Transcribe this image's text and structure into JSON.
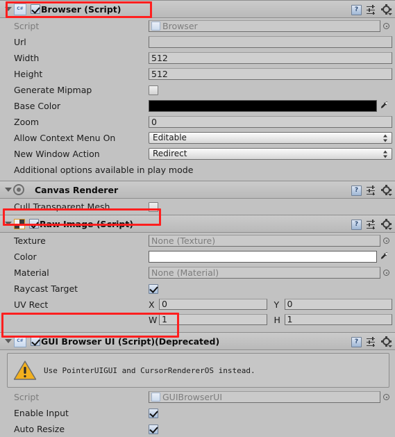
{
  "window": {
    "app": "Unity Inspector",
    "background": "#c2c2c2",
    "annotation_color": "#ff1f1f"
  },
  "header_icons": {
    "help": "?",
    "help_name": "help-icon",
    "preset_name": "preset-icon",
    "gear_name": "gear-icon"
  },
  "components": [
    {
      "name": "browser",
      "title": "Browser (Script)",
      "icon": "csharp-script-icon",
      "enabled": true,
      "highlighted": true,
      "rows": [
        {
          "kind": "object",
          "label": "Script",
          "label_dim": true,
          "value": "Browser",
          "has_picker": true
        },
        {
          "kind": "text",
          "label": "Url",
          "value": ""
        },
        {
          "kind": "text",
          "label": "Width",
          "value": "512"
        },
        {
          "kind": "text",
          "label": "Height",
          "value": "512"
        },
        {
          "kind": "checkbox",
          "label": "Generate Mipmap",
          "checked": false
        },
        {
          "kind": "color",
          "label": "Base Color",
          "color": "#000000"
        },
        {
          "kind": "text",
          "label": "Zoom",
          "value": "0"
        },
        {
          "kind": "dropdown",
          "label": "Allow Context Menu On",
          "value": "Editable"
        },
        {
          "kind": "dropdown",
          "label": "New Window Action",
          "value": "Redirect"
        },
        {
          "kind": "note",
          "label": "Additional options available in play mode"
        }
      ]
    },
    {
      "name": "canvas-renderer",
      "title": "Canvas Renderer",
      "icon": "canvas-renderer-icon",
      "enabled": null,
      "highlighted": false,
      "rows": [
        {
          "kind": "checkbox",
          "label": "Cull Transparent Mesh",
          "checked": false
        }
      ]
    },
    {
      "name": "raw-image",
      "title": "Raw Image (Script)",
      "icon": "checker-texture-icon",
      "enabled": true,
      "highlighted": true,
      "rows": [
        {
          "kind": "object",
          "label": "Texture",
          "value": "None (Texture)",
          "has_picker": true
        },
        {
          "kind": "color",
          "label": "Color",
          "color": "#ffffff"
        },
        {
          "kind": "object",
          "label": "Material",
          "value": "None (Material)",
          "has_picker": true
        },
        {
          "kind": "checkbox",
          "label": "Raycast Target",
          "checked": true
        },
        {
          "kind": "vector2",
          "label": "UV Rect",
          "fields": [
            {
              "axis": "X",
              "value": "0"
            },
            {
              "axis": "Y",
              "value": "0"
            }
          ]
        },
        {
          "kind": "vector2",
          "label": "",
          "fields": [
            {
              "axis": "W",
              "value": "1"
            },
            {
              "axis": "H",
              "value": "1"
            }
          ]
        }
      ]
    },
    {
      "name": "gui-browser-ui",
      "title": "GUI Browser UI (Script)",
      "title_suffix": "(Deprecated)",
      "icon": "csharp-script-icon",
      "enabled": true,
      "highlighted": true,
      "warning": "Use PointerUIGUI and CursorRendererOS instead.",
      "rows": [
        {
          "kind": "object",
          "label": "Script",
          "label_dim": true,
          "value": "GUIBrowserUI",
          "has_picker": true
        },
        {
          "kind": "checkbox",
          "label": "Enable Input",
          "checked": true
        },
        {
          "kind": "checkbox",
          "label": "Auto Resize",
          "checked": true
        }
      ]
    }
  ]
}
